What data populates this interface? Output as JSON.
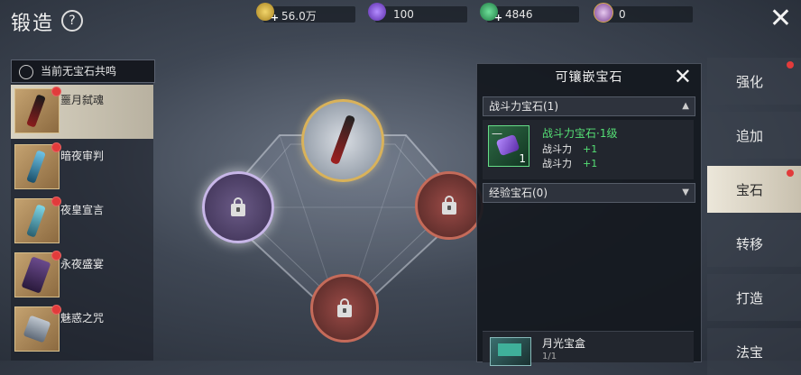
{
  "header": {
    "title": "锻造",
    "help_icon": "?"
  },
  "resources": [
    {
      "name": "gold-coin",
      "value": "56.0万",
      "color": "#d8b34a"
    },
    {
      "name": "purple-crystal",
      "value": "100",
      "color": "#8b5cd6"
    },
    {
      "name": "green-gem",
      "value": "4846",
      "color": "#38b56a"
    },
    {
      "name": "star-token",
      "value": "0",
      "color": "#c38bd6"
    }
  ],
  "gem_status": "当前无宝石共鸣",
  "equipment": [
    {
      "name": "噩月弑魂",
      "selected": true
    },
    {
      "name": "暗夜审判",
      "selected": false
    },
    {
      "name": "夜皇宣言",
      "selected": false
    },
    {
      "name": "永夜盛宴",
      "selected": false
    },
    {
      "name": "魅惑之咒",
      "selected": false
    }
  ],
  "panel": {
    "title": "可镶嵌宝石",
    "category1": "战斗力宝石(1)",
    "category2": "经验宝石(0)",
    "gem": {
      "name": "战斗力宝石·1级",
      "count": "1",
      "dash": "一",
      "stats": [
        {
          "label": "战斗力",
          "value": "+1"
        },
        {
          "label": "战斗力",
          "value": "+1"
        }
      ]
    },
    "box": {
      "name": "月光宝盒",
      "count": "1/1"
    }
  },
  "tabs": [
    {
      "label": "强化",
      "active": false,
      "dot": true
    },
    {
      "label": "追加",
      "active": false,
      "dot": false
    },
    {
      "label": "宝石",
      "active": true,
      "dot": true
    },
    {
      "label": "转移",
      "active": false,
      "dot": false
    },
    {
      "label": "打造",
      "active": false,
      "dot": false
    },
    {
      "label": "法宝",
      "active": false,
      "dot": false
    }
  ]
}
